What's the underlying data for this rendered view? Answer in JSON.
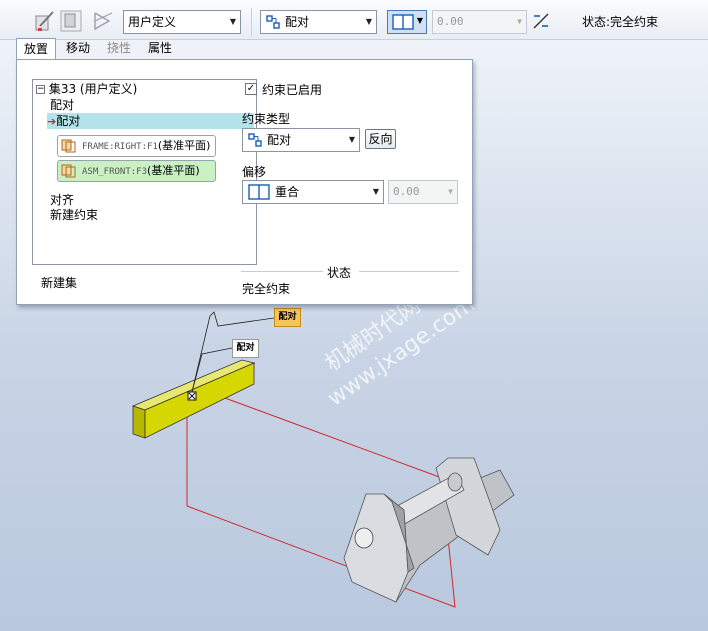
{
  "toolbar": {
    "placement_mode": "用户定义",
    "constraint_type": "配对",
    "offset_value": "0.00",
    "status": "状态:完全约束"
  },
  "tabs": [
    {
      "label": "放置",
      "state": "active"
    },
    {
      "label": "移动",
      "state": "normal"
    },
    {
      "label": "挠性",
      "state": "disabled"
    },
    {
      "label": "属性",
      "state": "normal"
    }
  ],
  "tree": {
    "set_label": "集33 (用户定义)",
    "item1": "配对",
    "item2_selected": "配对",
    "ref1_code": "FRAME:RIGHT:F1",
    "ref1_name": "(基准平面)",
    "ref2_code": "ASM_FRONT:F3",
    "ref2_name": "(基准平面)",
    "item3": "对齐",
    "new_constraint": "新建约束",
    "new_set": "新建集"
  },
  "constraint": {
    "enabled_label": "约束已启用",
    "enabled": true,
    "type_heading": "约束类型",
    "type_value": "配对",
    "flip_button": "反向",
    "offset_heading": "偏移",
    "offset_mode": "重合",
    "offset_value": "0.00",
    "status_heading": "状态",
    "status_value": "完全约束"
  },
  "scene": {
    "tag1": "配对",
    "tag2": "配对",
    "watermark1": "机械时代网",
    "watermark2": "www.jxage.com"
  },
  "colors": {
    "tree_selection": "#b4e3ec",
    "ref_highlight": "#c9f1c4",
    "part_yellow": "#d6d600",
    "datum_red": "#d0282a",
    "tag_orange": "#f7c45c"
  }
}
